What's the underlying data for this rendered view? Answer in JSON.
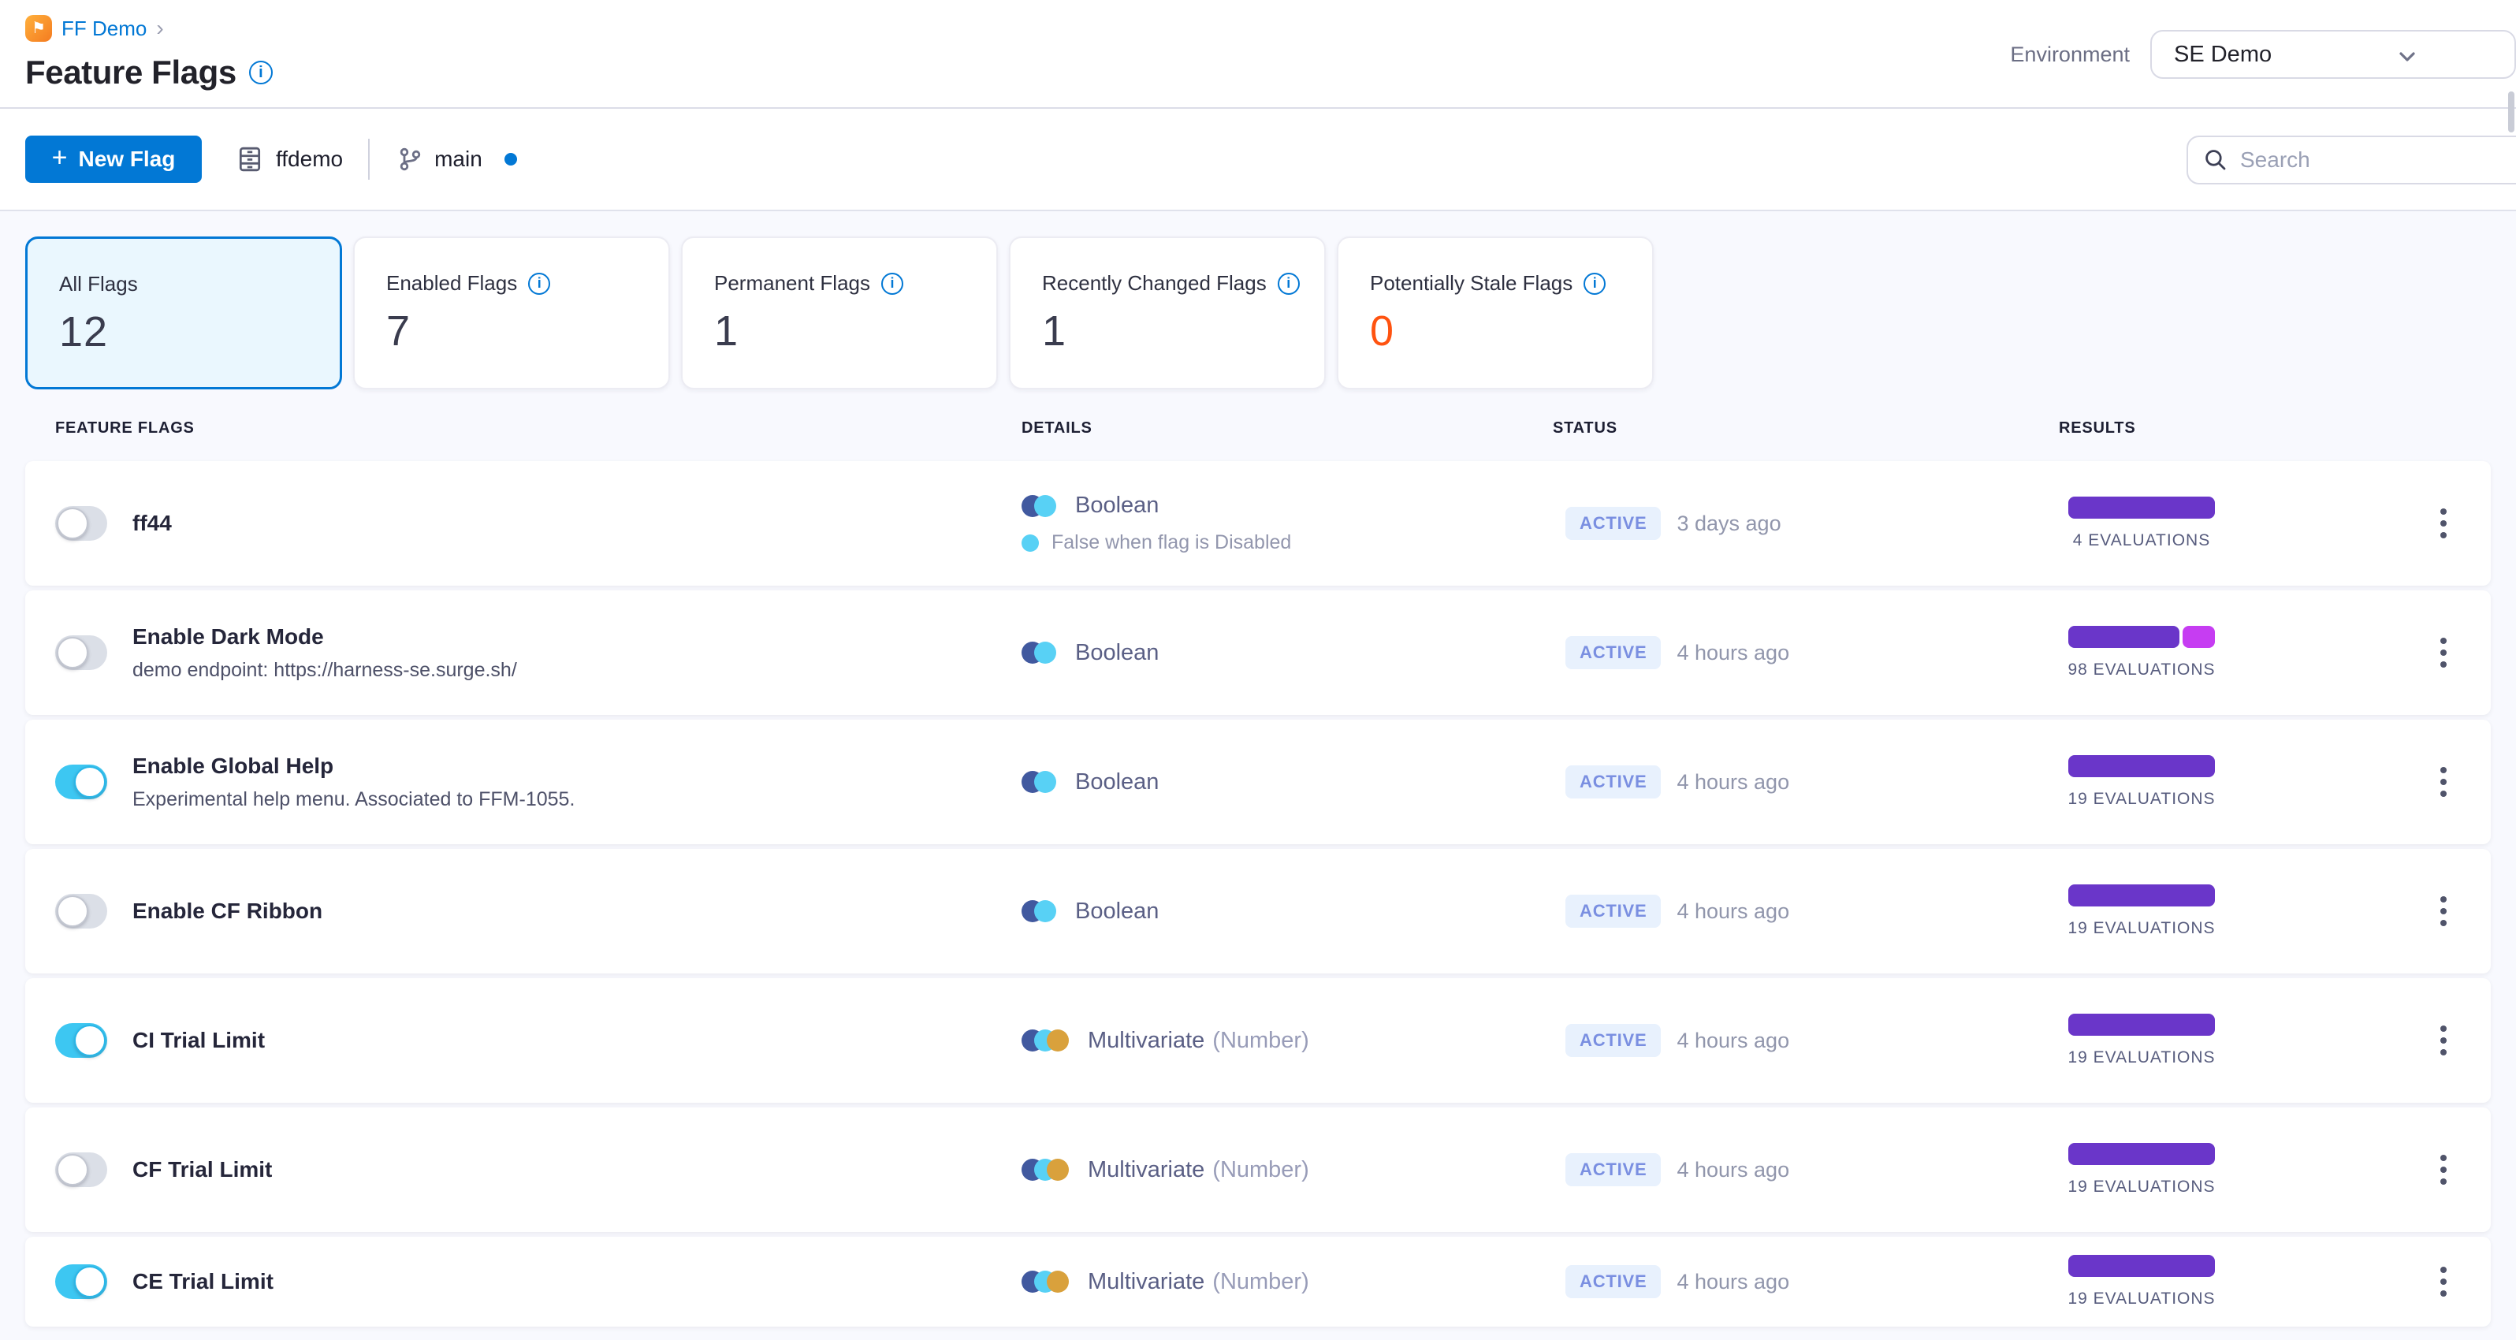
{
  "breadcrumb": {
    "project": "FF Demo"
  },
  "header": {
    "title": "Feature Flags",
    "environment_label": "Environment",
    "environment_value": "SE Demo"
  },
  "toolbar": {
    "new_flag_plus": "+",
    "new_flag_label": "New Flag",
    "repo": "ffdemo",
    "branch": "main",
    "search_placeholder": "Search"
  },
  "summary_cards": [
    {
      "label": "All Flags",
      "value": "12",
      "info": false,
      "selected": true
    },
    {
      "label": "Enabled Flags",
      "value": "7",
      "info": true,
      "selected": false
    },
    {
      "label": "Permanent Flags",
      "value": "1",
      "info": true,
      "selected": false
    },
    {
      "label": "Recently Changed Flags",
      "value": "1",
      "info": true,
      "selected": false
    },
    {
      "label": "Potentially Stale Flags",
      "value": "0",
      "info": true,
      "selected": false,
      "value_color": "#ff5310"
    }
  ],
  "table": {
    "columns": [
      "FEATURE FLAGS",
      "DETAILS",
      "STATUS",
      "RESULTS"
    ]
  },
  "rows": [
    {
      "name": "ff44",
      "description": "",
      "enabled": false,
      "icon": "boolean",
      "kind": "Boolean",
      "kind_detail": "",
      "sub_note": "False when flag is Disabled",
      "status": "ACTIVE",
      "updated": "3 days ago",
      "evaluations": "4 EVALUATIONS",
      "segments": [
        {
          "color": "#6a36c9",
          "pct": 100
        }
      ]
    },
    {
      "name": "Enable Dark Mode",
      "description": "demo endpoint: https://harness-se.surge.sh/",
      "enabled": false,
      "icon": "boolean",
      "kind": "Boolean",
      "kind_detail": "",
      "sub_note": "",
      "status": "ACTIVE",
      "updated": "4 hours ago",
      "evaluations": "98 EVALUATIONS",
      "segments": [
        {
          "color": "#6a36c9",
          "pct": 76
        },
        {
          "color": "#c63df2",
          "pct": 22
        }
      ]
    },
    {
      "name": "Enable Global Help",
      "description": "Experimental help menu. Associated to FFM-1055.",
      "enabled": true,
      "icon": "boolean",
      "kind": "Boolean",
      "kind_detail": "",
      "sub_note": "",
      "status": "ACTIVE",
      "updated": "4 hours ago",
      "evaluations": "19 EVALUATIONS",
      "segments": [
        {
          "color": "#6a36c9",
          "pct": 100
        }
      ]
    },
    {
      "name": "Enable CF Ribbon",
      "description": "",
      "enabled": false,
      "icon": "boolean",
      "kind": "Boolean",
      "kind_detail": "",
      "sub_note": "",
      "status": "ACTIVE",
      "updated": "4 hours ago",
      "evaluations": "19 EVALUATIONS",
      "segments": [
        {
          "color": "#6a36c9",
          "pct": 100
        }
      ]
    },
    {
      "name": "CI Trial Limit",
      "description": "",
      "enabled": true,
      "icon": "multivariate",
      "kind": "Multivariate",
      "kind_detail": "(Number)",
      "sub_note": "",
      "status": "ACTIVE",
      "updated": "4 hours ago",
      "evaluations": "19 EVALUATIONS",
      "segments": [
        {
          "color": "#6a36c9",
          "pct": 100
        }
      ]
    },
    {
      "name": "CF Trial Limit",
      "description": "",
      "enabled": false,
      "icon": "multivariate",
      "kind": "Multivariate",
      "kind_detail": "(Number)",
      "sub_note": "",
      "status": "ACTIVE",
      "updated": "4 hours ago",
      "evaluations": "19 EVALUATIONS",
      "segments": [
        {
          "color": "#6a36c9",
          "pct": 100
        }
      ]
    },
    {
      "name": "CE Trial Limit",
      "description": "",
      "enabled": true,
      "icon": "multivariate",
      "kind": "Multivariate",
      "kind_detail": "(Number)",
      "sub_note": "",
      "status": "ACTIVE",
      "updated": "4 hours ago",
      "evaluations": "19 EVALUATIONS",
      "segments": [
        {
          "color": "#6a36c9",
          "pct": 100
        }
      ]
    }
  ],
  "colors": {
    "primary_blue": "#0278d5",
    "toggle_on_cyan": "#3dc7f2",
    "eval_purple": "#6a36c9",
    "eval_magenta": "#c63df2",
    "stale_orange": "#ff5310",
    "active_badge_bg": "#e8f1fd",
    "active_badge_text": "#7a8fe1",
    "boolean_navy": "#41599f",
    "boolean_cyan": "#58d1f5",
    "multivariate_gold": "#d9a13c"
  }
}
